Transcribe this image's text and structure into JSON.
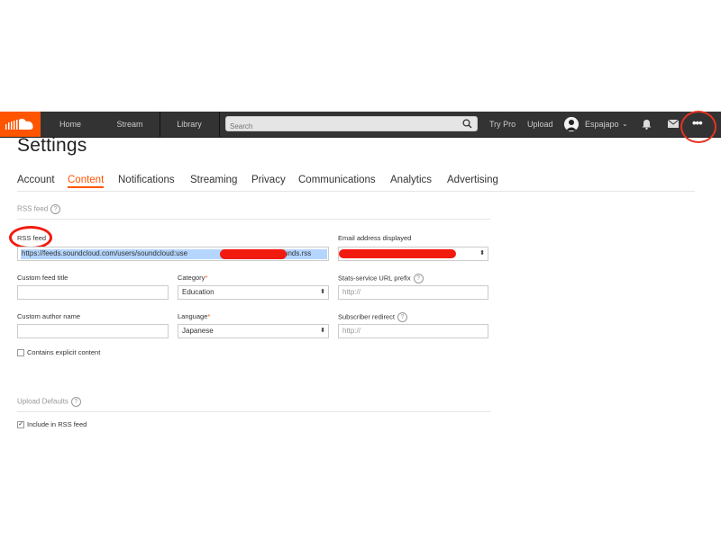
{
  "topbar": {
    "nav": [
      "Home",
      "Stream",
      "Library"
    ],
    "search_placeholder": "Search",
    "try_pro": "Try Pro",
    "upload": "Upload",
    "username": "Espajapo",
    "chevron": "⌄",
    "more": "•••"
  },
  "colors": {
    "brand": "#ff5500",
    "topbar": "#333333",
    "annotation_red": "#f21b0f"
  },
  "page": {
    "title": "Settings",
    "tabs": [
      "Account",
      "Content",
      "Notifications",
      "Streaming",
      "Privacy",
      "Communications",
      "Analytics",
      "Advertising"
    ],
    "active_tab": "Content"
  },
  "rss_section": {
    "heading": "RSS feed",
    "help": "?",
    "rss_feed_label": "RSS feed",
    "rss_feed_value_start": "https://feeds.soundcloud.com/users/soundcloud:use",
    "rss_feed_value_end": "unds.rss",
    "email_label": "Email address displayed",
    "custom_feed_title_label": "Custom feed title",
    "custom_feed_title_value": "",
    "category_label": "Category",
    "category_value": "Education",
    "stats_label": "Stats-service URL prefix",
    "stats_placeholder": "http://",
    "custom_author_label": "Custom author name",
    "custom_author_value": "",
    "language_label": "Language",
    "language_value": "Japanese",
    "subscriber_label": "Subscriber redirect",
    "subscriber_placeholder": "http://",
    "explicit_label": "Contains explicit content",
    "explicit_checked": false
  },
  "upload_defaults": {
    "heading": "Upload Defaults",
    "help": "?",
    "include_rss_label": "Include in RSS feed",
    "include_rss_checked": true
  }
}
